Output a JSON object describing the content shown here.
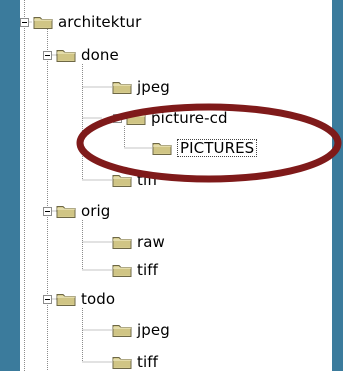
{
  "background_color": "#3b7b9c",
  "annotation_color": "#7f1a1a",
  "tree": {
    "nodes": [
      {
        "id": "architektur",
        "label": "architektur",
        "expanded": true,
        "icon": "folder-icon"
      },
      {
        "id": "done",
        "label": "done",
        "expanded": true,
        "icon": "folder-icon"
      },
      {
        "id": "jpeg-1",
        "label": "jpeg",
        "icon": "folder-icon"
      },
      {
        "id": "picture-cd",
        "label": "picture-cd",
        "expanded": true,
        "icon": "folder-icon"
      },
      {
        "id": "pictures",
        "label": "PICTURES",
        "selected": true,
        "icon": "folder-icon"
      },
      {
        "id": "tiff-1",
        "label": "tiff",
        "icon": "folder-icon"
      },
      {
        "id": "orig",
        "label": "orig",
        "expanded": true,
        "icon": "folder-icon"
      },
      {
        "id": "raw",
        "label": "raw",
        "icon": "folder-icon"
      },
      {
        "id": "tiff-2",
        "label": "tiff",
        "icon": "folder-icon"
      },
      {
        "id": "todo",
        "label": "todo",
        "expanded": true,
        "icon": "folder-icon"
      },
      {
        "id": "jpeg-2",
        "label": "jpeg",
        "icon": "folder-icon"
      },
      {
        "id": "tiff-3",
        "label": "tiff",
        "icon": "folder-icon"
      }
    ]
  },
  "annotation": {
    "icon": "ellipse-highlight",
    "target": "picture-cd"
  }
}
